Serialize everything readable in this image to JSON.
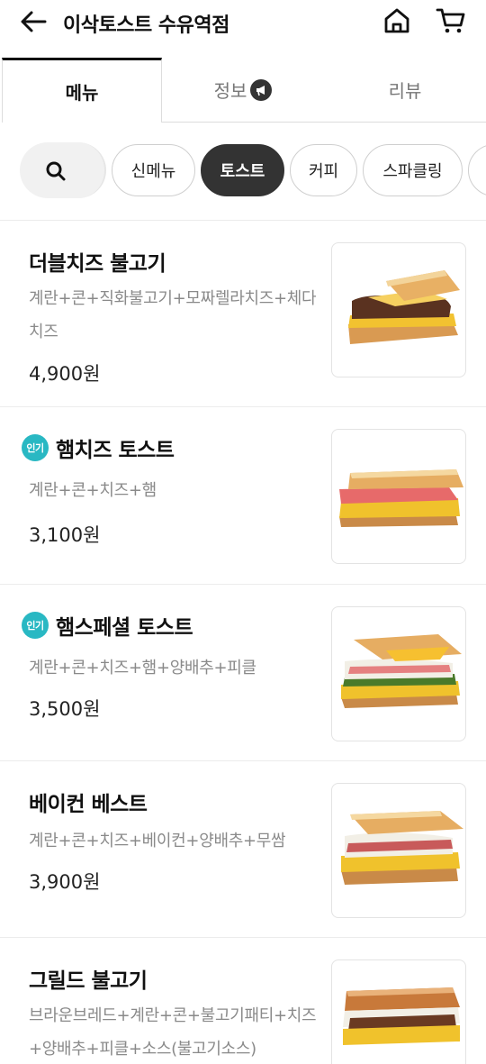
{
  "header": {
    "title": "이삭토스트 수유역점"
  },
  "tabs": [
    {
      "label": "메뉴"
    },
    {
      "label": "정보"
    },
    {
      "label": "리뷰"
    }
  ],
  "categories": [
    {
      "label": "신메뉴"
    },
    {
      "label": "토스트"
    },
    {
      "label": "커피"
    },
    {
      "label": "스파클링"
    }
  ],
  "items": [
    {
      "name": "더블치즈 불고기",
      "desc": "계란+콘+직화불고기+모짜렐라치즈+체다치즈",
      "price": "4,900원",
      "badge": ""
    },
    {
      "name": "햄치즈 토스트",
      "desc": "계란+콘+치즈+햄",
      "price": "3,100원",
      "badge": "인기"
    },
    {
      "name": "햄스페셜 토스트",
      "desc": "계란+콘+치즈+햄+양배추+피클",
      "price": "3,500원",
      "badge": "인기"
    },
    {
      "name": "베이컨 베스트",
      "desc": "계란+콘+치즈+베이컨+양배추+무쌈",
      "price": "3,900원",
      "badge": ""
    },
    {
      "name": "그릴드 불고기",
      "desc": "브라운브레드+계란+콘+불고기패티+치즈+양배추+피클+소스(불고기소스)",
      "price": "",
      "badge": ""
    }
  ],
  "colors": {
    "accent_dark": "#333333",
    "badge": "#29b8c3",
    "desc_text": "#8a8a8a"
  },
  "icons": [
    "back-arrow-icon",
    "home-icon",
    "cart-icon",
    "megaphone-icon",
    "search-icon"
  ]
}
